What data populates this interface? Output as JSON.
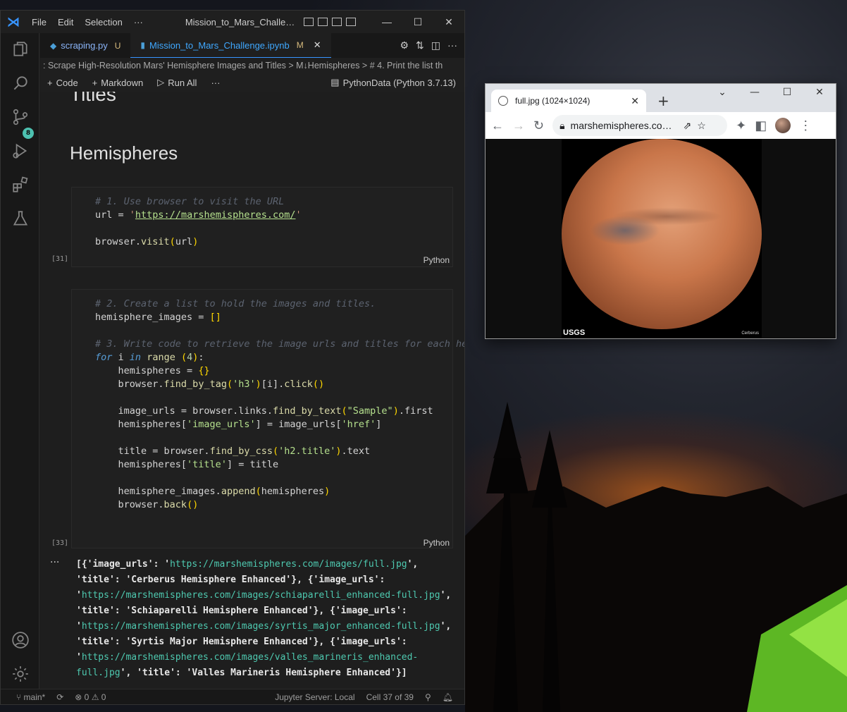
{
  "vscode": {
    "menu": [
      "File",
      "Edit",
      "Selection",
      "···"
    ],
    "window_title": "Mission_to_Mars_Challenge...",
    "tabs": [
      {
        "label": "scraping.py",
        "status": "U"
      },
      {
        "label": "Mission_to_Mars_Challenge.ipynb",
        "status": "M"
      }
    ],
    "breadcrumb": ": Scrape High-Resolution Mars' Hemisphere Images and Titles  >  M↓Hemispheres  >  # 4. Print the list th",
    "toolbar": {
      "code": "Code",
      "markdown": "Markdown",
      "run_all": "Run All",
      "more": "···",
      "kernel": "PythonData (Python 3.7.13)"
    },
    "md_titles": "Titles",
    "md_heading": "Hemispheres",
    "cells": [
      {
        "exec": "[31]",
        "lang": "Python"
      },
      {
        "exec": "[33]",
        "lang": "Python"
      }
    ],
    "source_control_badge": "8",
    "output_ellipsis": "···",
    "output": [
      {
        "pre": "[{'image_urls': '",
        "url": "https://marshemispheres.com/images/full.jpg",
        "post": "',\n'title': 'Cerberus Hemisphere Enhanced'}, {'image_urls':\n'"
      },
      {
        "pre": "",
        "url": "https://marshemispheres.com/images/schiaparelli_enhanced-full.jpg",
        "post": "',\n'title': 'Schiaparelli Hemisphere Enhanced'}, {'image_urls':\n'"
      },
      {
        "pre": "",
        "url": "https://marshemispheres.com/images/syrtis_major_enhanced-full.jpg",
        "post": "',\n'title': 'Syrtis Major Hemisphere Enhanced'}, {'image_urls':\n'"
      },
      {
        "pre": "",
        "url": "https://marshemispheres.com/images/valles_marineris_enhanced-\nfull.jpg",
        "post": "', 'title': 'Valles Marineris Hemisphere Enhanced'}]"
      }
    ],
    "status": {
      "branch": "main*",
      "problems": "⊗ 0 ⚠ 0",
      "jupyter": "Jupyter Server: Local",
      "cell": "Cell 37 of 39"
    }
  },
  "chrome": {
    "tab_title": "full.jpg (1024×1024)",
    "address": "marshemispheres.com...",
    "image_logo": "USGS",
    "image_caption": "Cerberus"
  }
}
